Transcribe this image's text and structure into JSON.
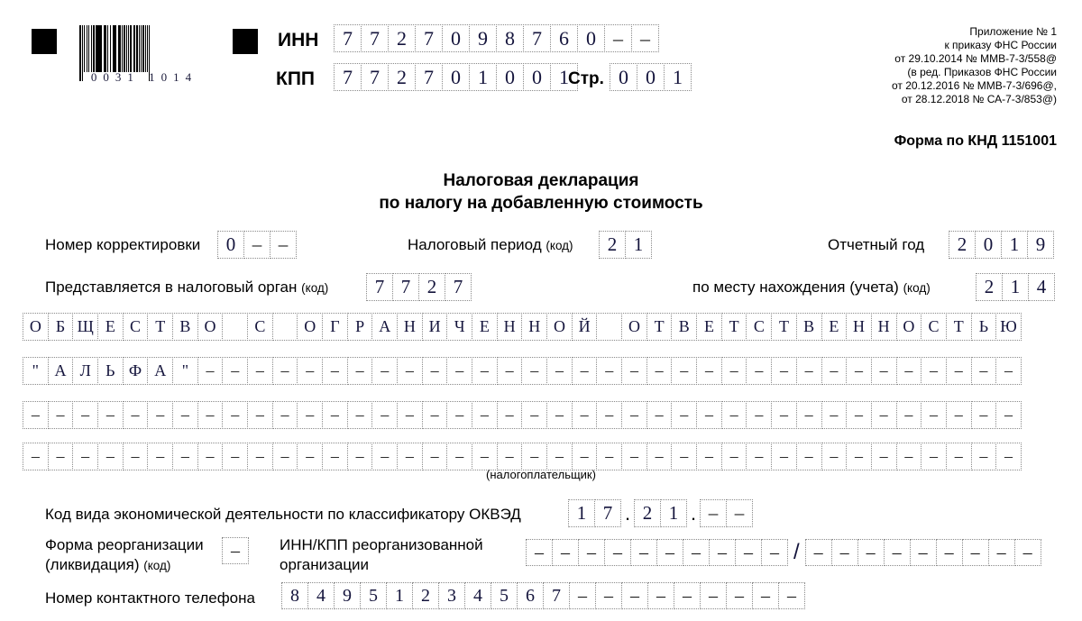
{
  "header": {
    "barcode_digits": "0031 1014",
    "barcode_pattern": [
      3,
      1,
      1,
      2,
      1,
      3,
      2,
      1,
      1,
      3,
      1,
      2,
      2,
      2,
      1,
      1,
      3,
      1,
      2,
      1,
      1,
      2,
      3,
      1,
      1,
      1,
      2,
      2,
      1,
      3,
      1,
      1,
      2,
      1,
      1,
      3,
      2,
      1,
      1,
      2,
      1,
      1,
      3,
      1,
      2,
      1,
      1,
      2,
      2,
      3,
      1,
      1,
      1,
      2,
      3,
      1,
      1,
      2,
      1,
      1,
      3,
      2,
      1,
      1,
      2,
      1,
      1,
      3
    ],
    "inn_label": "ИНН",
    "inn_value": "7727098760--",
    "kpp_label": "КПП",
    "kpp_value": "772701001",
    "page_label": "Стр.",
    "page_value": "001"
  },
  "annotation": {
    "lines": [
      "Приложение № 1",
      "к приказу ФНС России",
      "от 29.10.2014 № ММВ-7-3/558@",
      "(в ред. Приказов ФНС России",
      "от 20.12.2016 № ММВ-7-3/696@,",
      "от 28.12.2018 № СА-7-3/853@)"
    ],
    "knd_form": "Форма по КНД 1151001"
  },
  "title": {
    "line1": "Налоговая декларация",
    "line2": "по налогу на добавленную стоимость"
  },
  "fields": {
    "correction_number": {
      "label": "Номер корректировки",
      "value": "0--"
    },
    "tax_period": {
      "label_main": "Налоговый период",
      "label_code": "(код)",
      "value": "21"
    },
    "reporting_year": {
      "label": "Отчетный год",
      "value": "2019"
    },
    "tax_authority": {
      "label_main": "Представляется в налоговый орган",
      "label_code": "(код)",
      "value": "7727"
    },
    "location_code": {
      "label_main": "по месту нахождения (учета)",
      "label_code": "(код)",
      "value": "214"
    },
    "okved": {
      "label": "Код вида экономической деятельности по классификатору ОКВЭД",
      "part1": "17",
      "part2": "21",
      "part3": "--",
      "separator": "."
    },
    "reorg_form": {
      "label_line1": "Форма реорганизации",
      "label_line2": "(ликвидация)",
      "label_code": "(код)",
      "value": "-"
    },
    "reorg_innkpp": {
      "label_line1": "ИНН/КПП реорганизованной",
      "label_line2": "организации",
      "inn_value": "----------",
      "separator": "/",
      "kpp_value": "---------"
    },
    "phone": {
      "label": "Номер контактного телефона",
      "value": "84951234567---------"
    }
  },
  "taxpayer": {
    "caption": "(налогоплательщик)",
    "rows": [
      "ОБЩЕСТВО С ОГРАНИЧЕННОЙ ОТВЕТСТВЕННОСТЬЮ",
      "\"АЛЬФА\"---------------------------------",
      "----------------------------------------",
      "----------------------------------------"
    ],
    "cells_per_row": 40
  },
  "colors": {
    "cell_border": "#8a8a8a",
    "text": "#000000",
    "value_text": "#14143c"
  }
}
